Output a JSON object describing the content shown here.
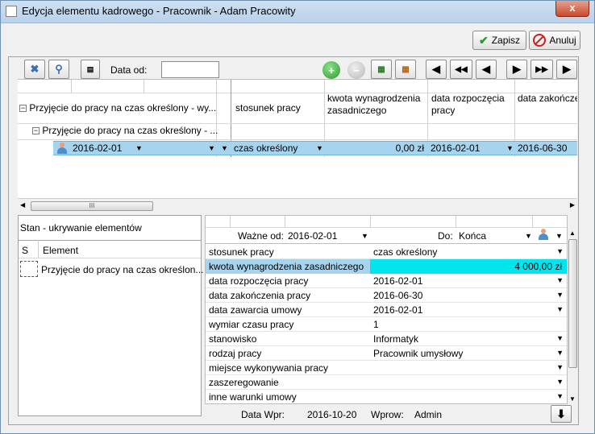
{
  "window": {
    "title": "Edycja elementu kadrowego - Pracownik - Adam Pracowity",
    "close_glyph": "x"
  },
  "actions": {
    "save_label": "Zapisz",
    "cancel_label": "Anuluj"
  },
  "toolbar": {
    "date_from_label": "Data od:",
    "date_from_value": "",
    "nav": [
      "◀",
      "◀◀",
      "◀",
      "▶",
      "▶▶",
      "▶"
    ]
  },
  "grid": {
    "tree_root": "Przyjęcie do pracy na czas określony - wy...",
    "tree_child": "Przyjęcie do pracy na czas określony - ...",
    "row_date": "2016-02-01",
    "columns": [
      "stosunek pracy",
      "kwota wynagrodzenia zasadniczego",
      "data rozpoczęcia pracy",
      "data zakończenia pracy"
    ],
    "values": {
      "stosunek": "czas określony",
      "kwota": "0,00 zł",
      "start": "2016-02-01",
      "end": "2016-06-30"
    },
    "scroll_glyph": "III"
  },
  "state_panel": {
    "title": "Stan - ukrywanie elementów",
    "col_s": "S",
    "col_element": "Element",
    "item": "Przyjęcie do pracy na czas określon..."
  },
  "props": {
    "valid_from_label": "Ważne od:",
    "valid_from_value": "2016-02-01",
    "to_label": "Do:",
    "to_value": "Końca",
    "rows": [
      {
        "key": "stosunek pracy",
        "value": "czas określony"
      },
      {
        "key": "kwota wynagrodzenia zasadniczego",
        "value": "4 000,00 zł"
      },
      {
        "key": "data rozpoczęcia pracy",
        "value": "2016-02-01"
      },
      {
        "key": "data zakończenia pracy",
        "value": "2016-06-30"
      },
      {
        "key": "data zawarcia umowy",
        "value": "2016-02-01"
      },
      {
        "key": "wymiar czasu pracy",
        "value": "1"
      },
      {
        "key": "stanowisko",
        "value": "Informatyk"
      },
      {
        "key": "rodzaj pracy",
        "value": "Pracownik umysłowy"
      },
      {
        "key": "miejsce wykonywania pracy",
        "value": ""
      },
      {
        "key": "zaszeregowanie",
        "value": ""
      },
      {
        "key": "inne warunki umowy",
        "value": ""
      }
    ]
  },
  "footer": {
    "data_wpr_label": "Data Wpr:",
    "data_wpr_value": "2016-10-20",
    "wprow_label": "Wprow:",
    "wprow_value": "Admin",
    "down_glyph": "⬇"
  },
  "colors": {
    "selection": "#a6d3ee",
    "highlight_value": "#00e5ee",
    "accent_green": "#2a9b2a",
    "accent_red": "#c8201e"
  }
}
